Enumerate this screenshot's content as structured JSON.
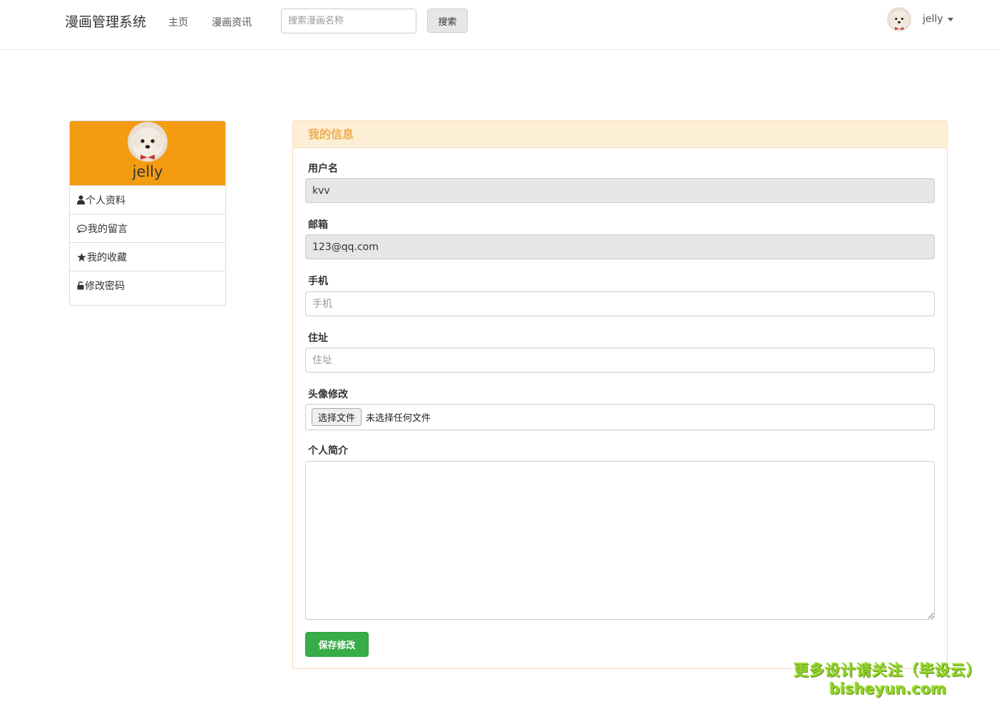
{
  "navbar": {
    "brand": "漫画管理系统",
    "links": [
      "主页",
      "漫画资讯"
    ],
    "search_placeholder": "搜索漫画名称",
    "search_button": "搜索",
    "user_name": "jelly"
  },
  "sidebar": {
    "user_name": "jelly",
    "items": [
      {
        "label": "个人资料",
        "icon": "user-icon"
      },
      {
        "label": "我的留言",
        "icon": "comment-icon"
      },
      {
        "label": "我的收藏",
        "icon": "star-icon"
      },
      {
        "label": "修改密码",
        "icon": "unlock-icon"
      }
    ]
  },
  "panel": {
    "title": "我的信息",
    "fields": {
      "username": {
        "label": "用户名",
        "value": "kvv"
      },
      "email": {
        "label": "邮箱",
        "value": "123@qq.com"
      },
      "phone": {
        "label": "手机",
        "placeholder": "手机"
      },
      "address": {
        "label": "住址",
        "placeholder": "住址"
      },
      "avatar": {
        "label": "头像修改",
        "button": "选择文件",
        "status": "未选择任何文件"
      },
      "bio": {
        "label": "个人简介"
      }
    },
    "save_button": "保存修改"
  },
  "watermark": {
    "line1": "更多设计请关注（毕设云）",
    "line2": "bisheyun.com"
  },
  "colors": {
    "sidebar_header": "#f39c12",
    "panel_heading_bg": "#fcefd6",
    "panel_heading_text": "#f0ad4e",
    "save_button": "#36ad47"
  }
}
